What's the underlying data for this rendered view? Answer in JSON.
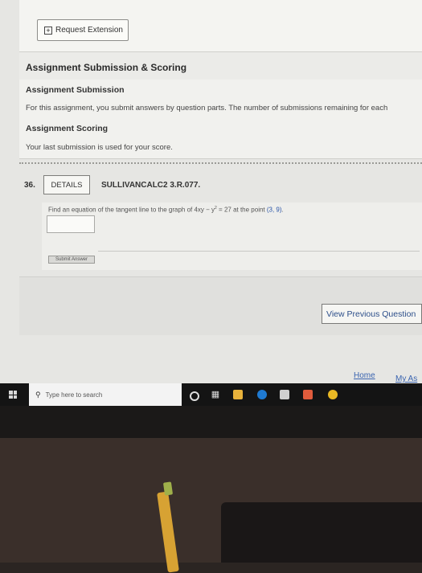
{
  "request_extension": {
    "label": "Request Extension"
  },
  "scoring": {
    "title": "Assignment Submission & Scoring",
    "submission_heading": "Assignment Submission",
    "submission_text": "For this assignment, you submit answers by question parts. The number of submissions remaining for each",
    "scoring_heading": "Assignment Scoring",
    "scoring_text": "Your last submission is used for your score."
  },
  "question": {
    "number": "36.",
    "details_label": "DETAILS",
    "code": "SULLIVANCALC2 3.R.077.",
    "prompt_before": "Find an equation of the tangent line to the graph of 4xy − y",
    "prompt_sup": "2",
    "prompt_mid": " = 27 at the point ",
    "prompt_point": "(3, 9)",
    "prompt_end": ".",
    "answer_value": "",
    "submit_label": "Submit Answer"
  },
  "nav": {
    "view_previous": "View Previous Question",
    "home": "Home",
    "my_assignments": "My As"
  },
  "taskbar": {
    "search_placeholder": "Type here to search",
    "icons": [
      "cortana-icon",
      "task-view-icon",
      "file-explorer-icon",
      "edge-icon",
      "store-icon",
      "mail-icon",
      "chrome-icon"
    ]
  },
  "colors": {
    "link": "#3a64b0",
    "point_highlight": "#2a55a8",
    "taskbar": "#141414"
  }
}
